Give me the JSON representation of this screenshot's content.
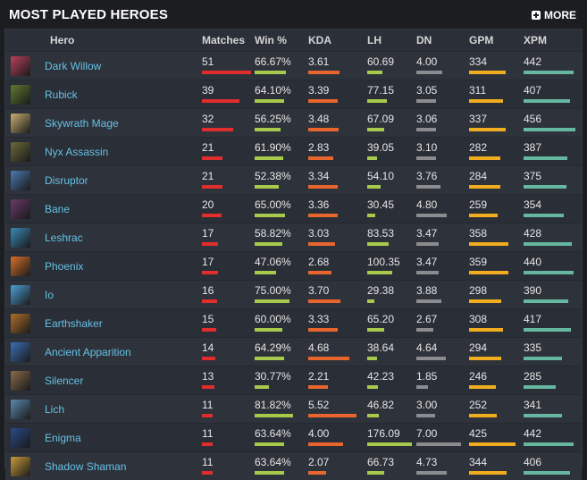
{
  "title": "MOST PLAYED HEROES",
  "more_label": "MORE",
  "columns": [
    "Hero",
    "Matches",
    "Win %",
    "KDA",
    "LH",
    "DN",
    "GPM",
    "XPM"
  ],
  "colors": {
    "matches_bar": "#e02d2d",
    "win_bar": "#a8ca4c",
    "kda_bar": "#e8662e",
    "lh_bar": "#a8ca4c",
    "dn_bar": "#8a8c8f",
    "gpm_bar": "#f0ad1f",
    "xpm_bar": "#66b7a0",
    "hero_name": "#66c1e6"
  },
  "heroes": [
    {
      "name": "Dark Willow",
      "matches": "51",
      "win": "66.67%",
      "kda": "3.61",
      "lh": "60.69",
      "dn": "4.00",
      "gpm": "334",
      "xpm": "442",
      "portrait_color": "#b8405a"
    },
    {
      "name": "Rubick",
      "matches": "39",
      "win": "64.10%",
      "kda": "3.39",
      "lh": "77.15",
      "dn": "3.05",
      "gpm": "311",
      "xpm": "407",
      "portrait_color": "#5f7a2e"
    },
    {
      "name": "Skywrath Mage",
      "matches": "32",
      "win": "56.25%",
      "kda": "3.48",
      "lh": "67.09",
      "dn": "3.06",
      "gpm": "337",
      "xpm": "456",
      "portrait_color": "#c8b070"
    },
    {
      "name": "Nyx Assassin",
      "matches": "21",
      "win": "61.90%",
      "kda": "2.83",
      "lh": "39.05",
      "dn": "3.10",
      "gpm": "282",
      "xpm": "387",
      "portrait_color": "#6a6a3a"
    },
    {
      "name": "Disruptor",
      "matches": "21",
      "win": "52.38%",
      "kda": "3.34",
      "lh": "54.10",
      "dn": "3.76",
      "gpm": "284",
      "xpm": "375",
      "portrait_color": "#4a7ab0"
    },
    {
      "name": "Bane",
      "matches": "20",
      "win": "65.00%",
      "kda": "3.36",
      "lh": "30.45",
      "dn": "4.80",
      "gpm": "259",
      "xpm": "354",
      "portrait_color": "#6a3a6a"
    },
    {
      "name": "Leshrac",
      "matches": "17",
      "win": "58.82%",
      "kda": "3.03",
      "lh": "83.53",
      "dn": "3.47",
      "gpm": "358",
      "xpm": "428",
      "portrait_color": "#3a8ab8"
    },
    {
      "name": "Phoenix",
      "matches": "17",
      "win": "47.06%",
      "kda": "2.68",
      "lh": "100.35",
      "dn": "3.47",
      "gpm": "359",
      "xpm": "440",
      "portrait_color": "#d8702a"
    },
    {
      "name": "Io",
      "matches": "16",
      "win": "75.00%",
      "kda": "3.70",
      "lh": "29.38",
      "dn": "3.88",
      "gpm": "298",
      "xpm": "390",
      "portrait_color": "#4aa0d8"
    },
    {
      "name": "Earthshaker",
      "matches": "15",
      "win": "60.00%",
      "kda": "3.33",
      "lh": "65.20",
      "dn": "2.67",
      "gpm": "308",
      "xpm": "417",
      "portrait_color": "#b0702a"
    },
    {
      "name": "Ancient Apparition",
      "matches": "14",
      "win": "64.29%",
      "kda": "4.68",
      "lh": "38.64",
      "dn": "4.64",
      "gpm": "294",
      "xpm": "335",
      "portrait_color": "#3a70b8"
    },
    {
      "name": "Silencer",
      "matches": "13",
      "win": "30.77%",
      "kda": "2.21",
      "lh": "42.23",
      "dn": "1.85",
      "gpm": "246",
      "xpm": "285",
      "portrait_color": "#8a6a4a"
    },
    {
      "name": "Lich",
      "matches": "11",
      "win": "81.82%",
      "kda": "5.52",
      "lh": "46.82",
      "dn": "3.00",
      "gpm": "252",
      "xpm": "341",
      "portrait_color": "#5a8ab0"
    },
    {
      "name": "Enigma",
      "matches": "11",
      "win": "63.64%",
      "kda": "4.00",
      "lh": "176.09",
      "dn": "7.00",
      "gpm": "425",
      "xpm": "442",
      "portrait_color": "#2a4a8a"
    },
    {
      "name": "Shadow Shaman",
      "matches": "11",
      "win": "63.64%",
      "kda": "2.07",
      "lh": "66.73",
      "dn": "4.73",
      "gpm": "344",
      "xpm": "406",
      "portrait_color": "#c89a3a"
    }
  ]
}
